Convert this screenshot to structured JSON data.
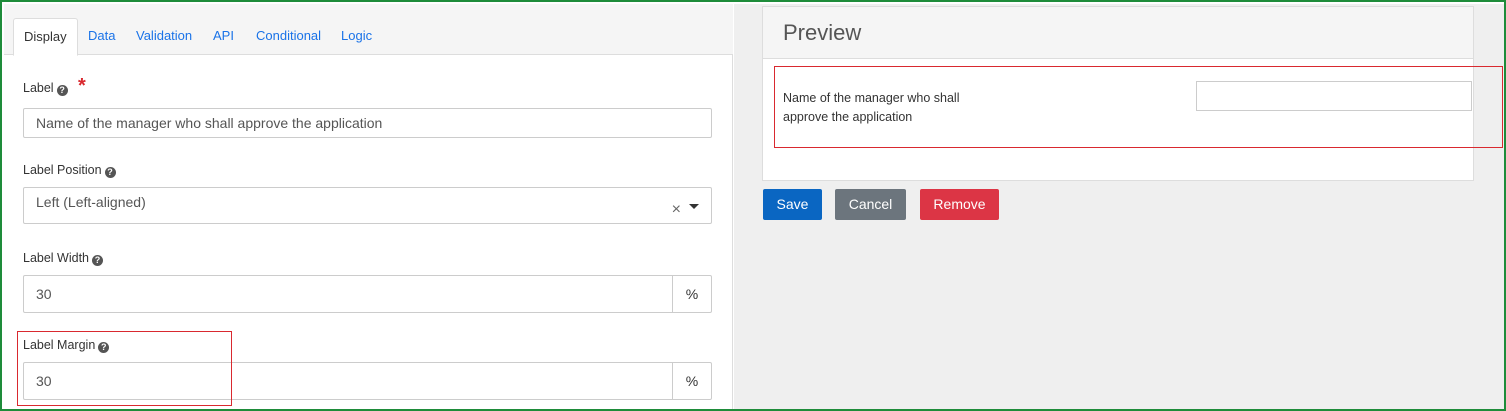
{
  "tabs": [
    {
      "label": "Display",
      "active": true
    },
    {
      "label": "Data"
    },
    {
      "label": "Validation"
    },
    {
      "label": "API"
    },
    {
      "label": "Conditional"
    },
    {
      "label": "Logic"
    }
  ],
  "fields": {
    "label": {
      "label": "Label",
      "required_mark": "*",
      "value": "Name of the manager who shall approve the application"
    },
    "label_position": {
      "label": "Label Position",
      "value": "Left (Left-aligned)",
      "clear_glyph": "×"
    },
    "label_width": {
      "label": "Label Width",
      "value": "30",
      "addon": "%"
    },
    "label_margin": {
      "label": "Label Margin",
      "value": "30",
      "addon": "%"
    }
  },
  "help_glyph": "?",
  "preview": {
    "title": "Preview",
    "field_label": "Name of the manager who shall approve the application"
  },
  "buttons": {
    "save": "Save",
    "cancel": "Cancel",
    "remove": "Remove"
  },
  "colors": {
    "save": "#0a66c2",
    "cancel": "#6c757d",
    "remove": "#dc3545",
    "highlight": "#d9292f",
    "frame": "#1e8c3a",
    "link": "#1a73e8"
  }
}
